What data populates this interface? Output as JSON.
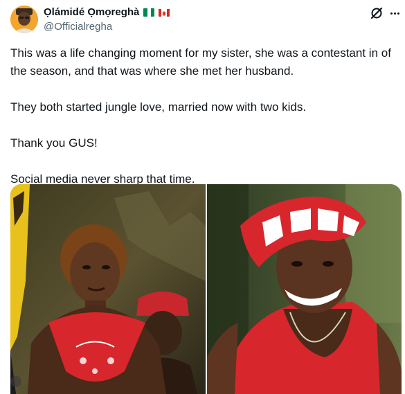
{
  "author": {
    "display_name": "Ọlámidé Ọmọreghà",
    "handle": "@Officialregha",
    "flags": [
      "nigeria-flag",
      "canada-flag"
    ],
    "avatar": "avatar"
  },
  "header_icons": [
    "grok-icon",
    "more-options-icon"
  ],
  "tweet": {
    "paragraphs": [
      "This was a life changing moment for my sister, she was a contestant in of the season, and that was where she met her husband.",
      "They both started jungle love, married now with two kids.",
      "Thank you GUS!",
      "Social media never sharp that time."
    ]
  },
  "media": {
    "images": [
      {
        "name": "photo-woman-red-scarf"
      },
      {
        "name": "photo-man-red-bandana"
      }
    ]
  },
  "colors": {
    "text": "#0f1419",
    "secondary_text": "#536471",
    "avatar_bg": "#f2a62e",
    "bandana_red": "#d8262d"
  }
}
